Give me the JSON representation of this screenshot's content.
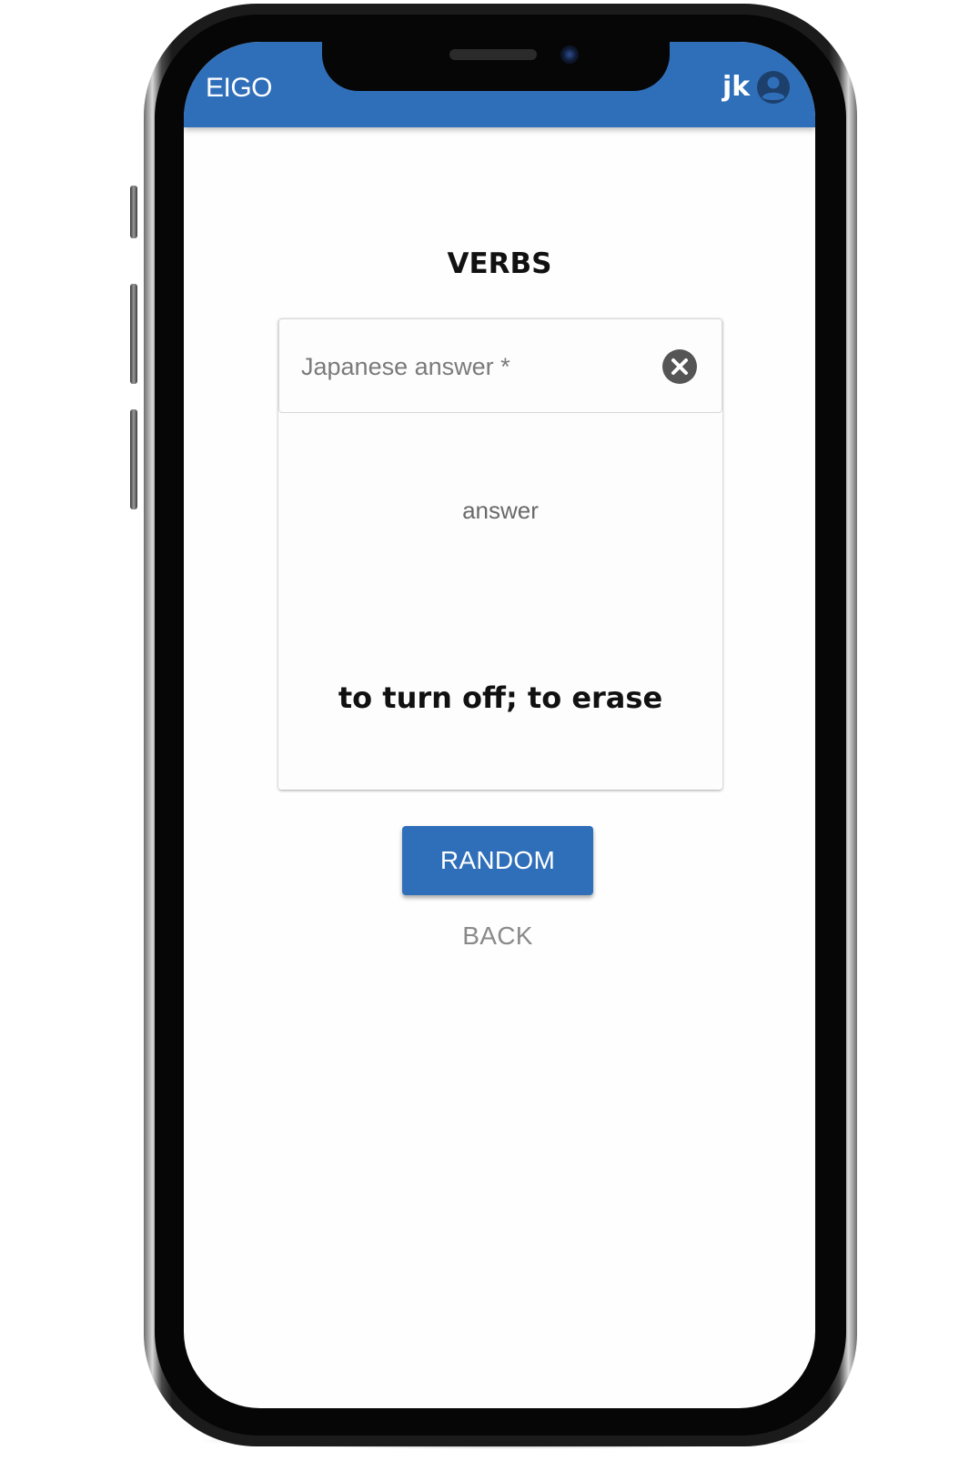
{
  "app_bar": {
    "title": "EIGO",
    "user_initials": "jk",
    "account_icon": "account-circle-icon",
    "color": "#2f6fba"
  },
  "main": {
    "section_title": "VERBS",
    "answer_field": {
      "placeholder": "Japanese answer *",
      "value": "",
      "clear_icon": "close-circle-icon"
    },
    "hint_label": "answer",
    "english_meaning": "to turn off; to erase",
    "random_label": "RANDOM",
    "back_label": "BACK"
  },
  "colors": {
    "primary": "#2f6fba",
    "text": "#111111",
    "muted": "#8a8a8a"
  }
}
